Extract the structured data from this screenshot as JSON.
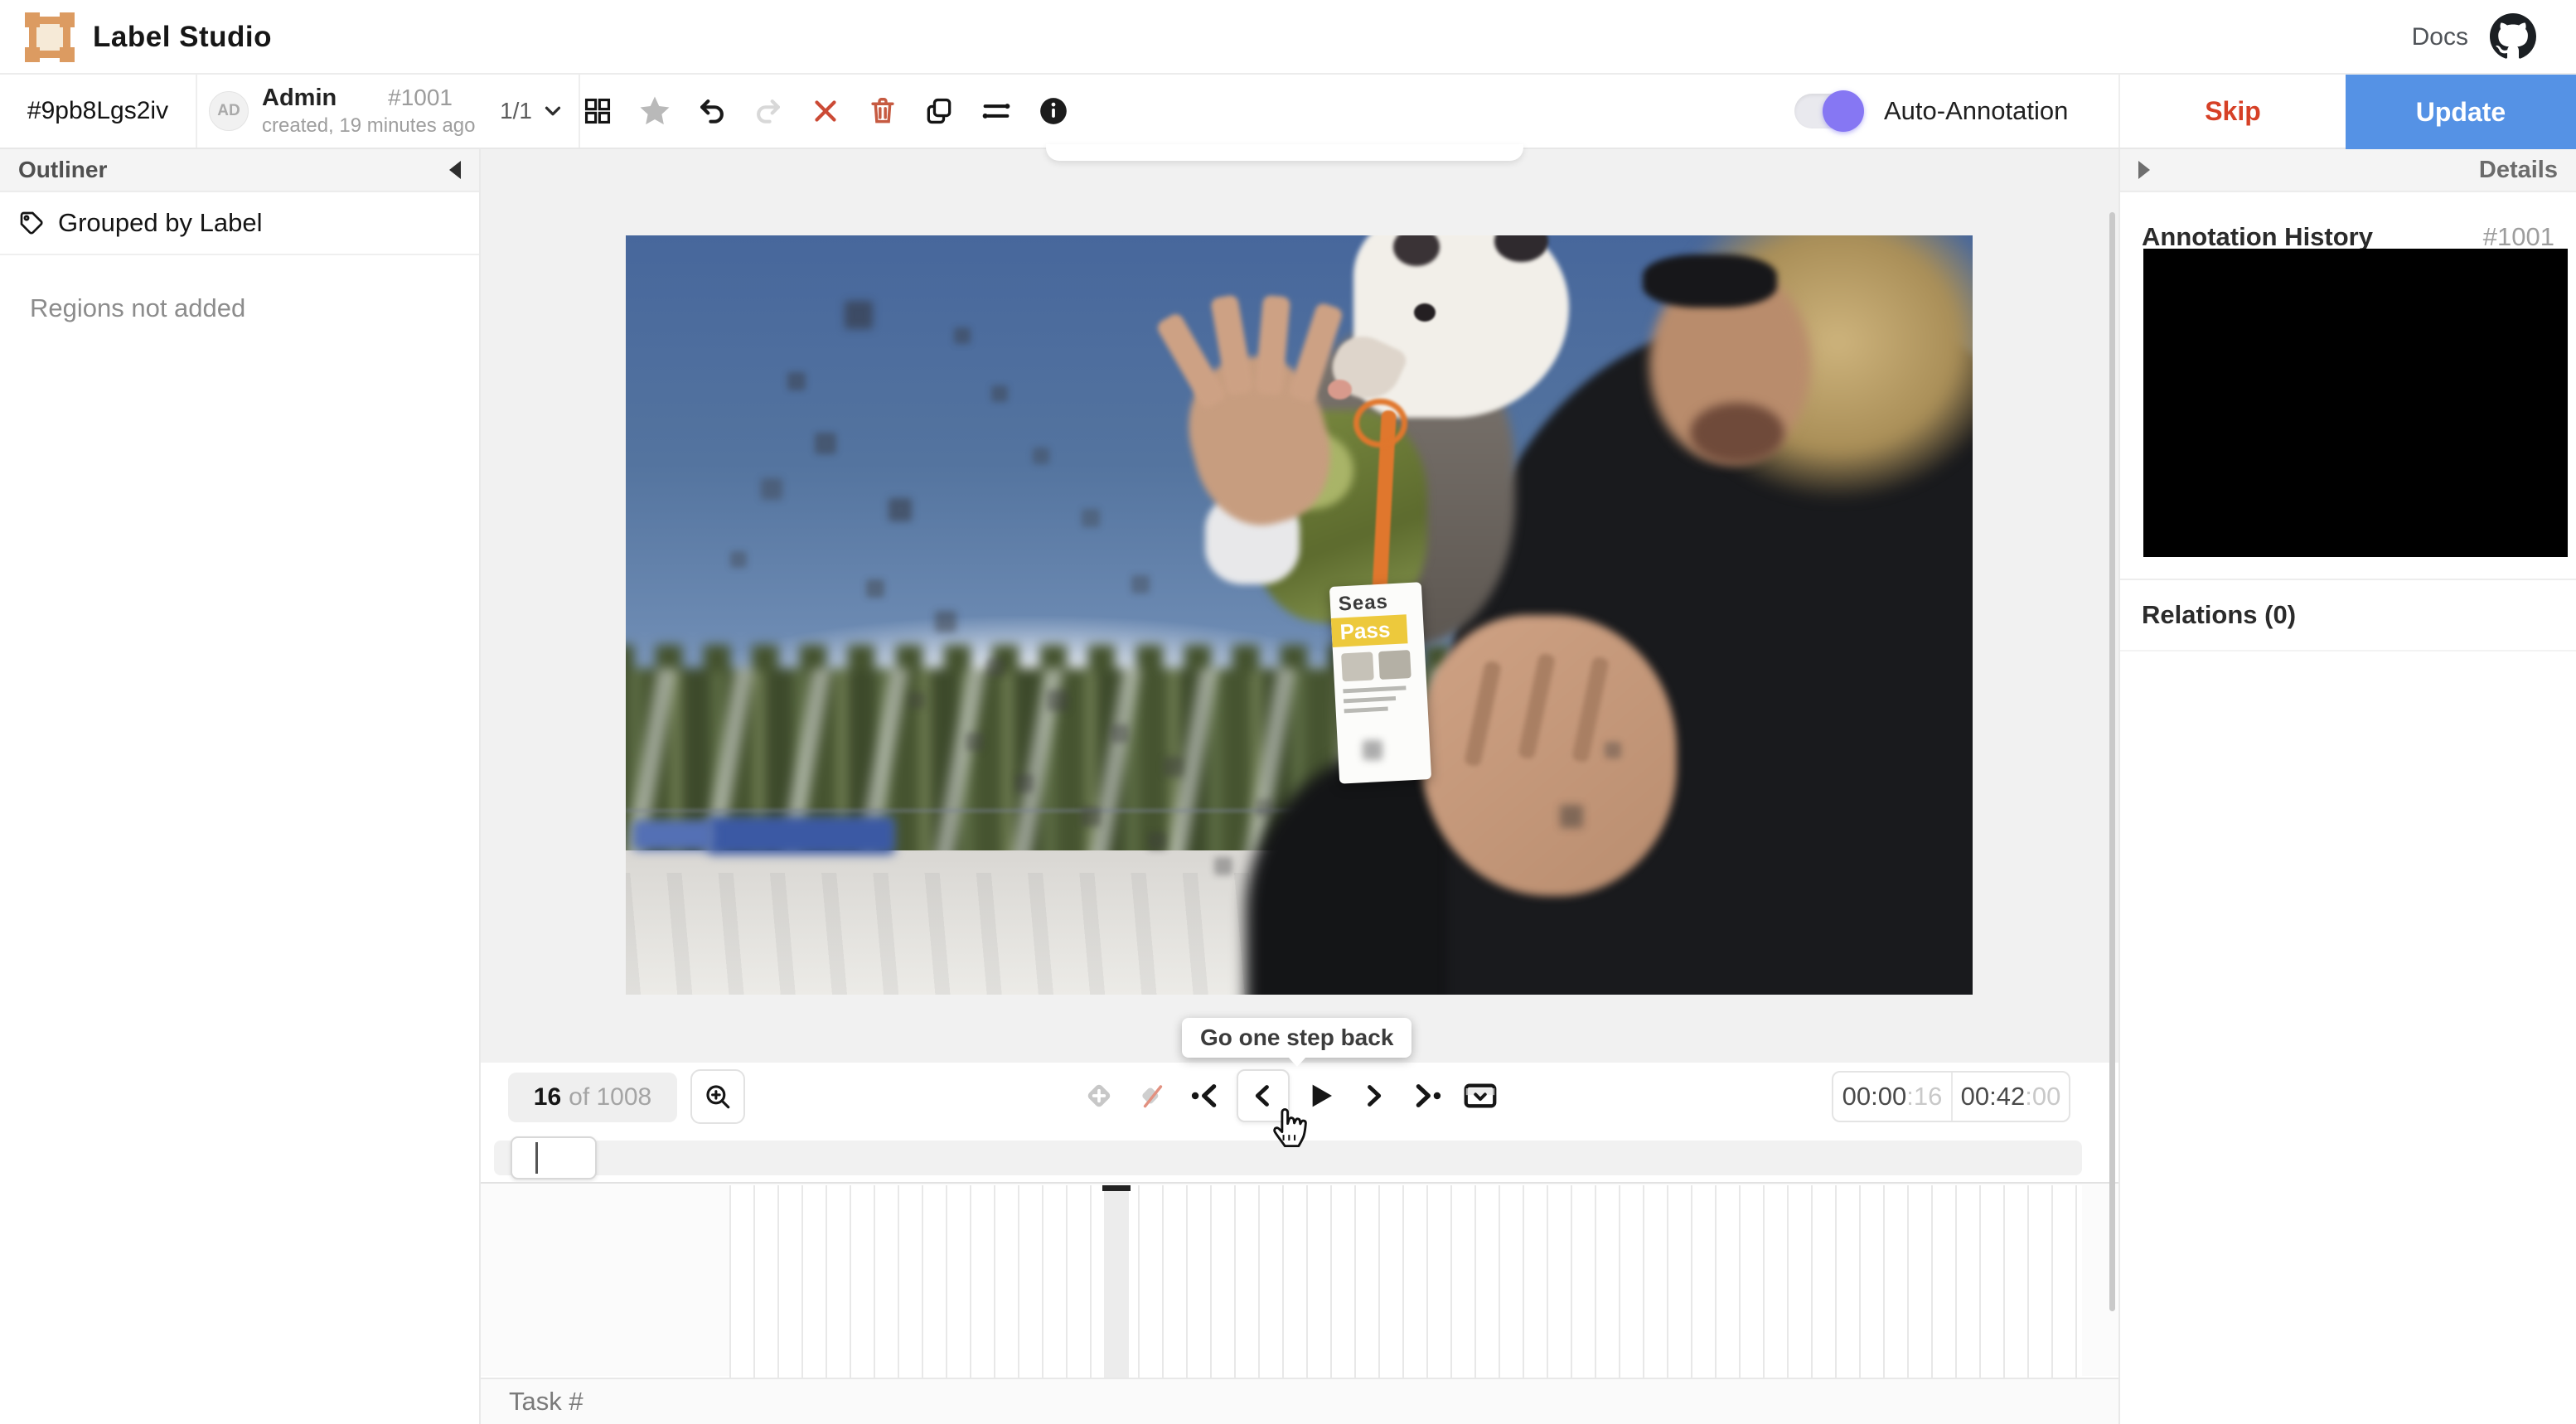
{
  "header": {
    "app_title": "Label Studio",
    "docs_label": "Docs"
  },
  "taskbar": {
    "task_id": "#9pb8Lgs2iv",
    "annotator": {
      "initials": "AD",
      "name": "Admin",
      "annotation_id": "#1001",
      "created_info": "created, 19 minutes ago",
      "pager": "1/1"
    },
    "toolbar_icons": [
      "grid-view",
      "star",
      "undo",
      "redo",
      "reject",
      "delete",
      "duplicate",
      "relations",
      "info"
    ],
    "auto_annotation_label": "Auto-Annotation",
    "skip_label": "Skip",
    "update_label": "Update"
  },
  "outliner": {
    "title": "Outliner",
    "grouping": "Grouped by Label",
    "empty_message": "Regions not added"
  },
  "player": {
    "frame_current": "16",
    "frame_total_label": "of 1008",
    "tooltip": "Go one step back",
    "time_current_main": "00:00",
    "time_current_frames": ":16",
    "time_total_main": "00:42",
    "time_total_frames": ":00"
  },
  "video_overlay": {
    "badge_line1": "Seas",
    "badge_line2": "Pass"
  },
  "details_panel": {
    "title": "Details",
    "history_title": "Annotation History",
    "history_id": "#1001",
    "relations_title": "Relations (0)"
  },
  "bottom_bar": {
    "task_label": "Task #"
  },
  "colors": {
    "accent_blue": "#5592e5",
    "skip_red": "#d64026",
    "toggle_violet": "#8677f3",
    "logo_orange": "#dc9b61",
    "danger_icon": "#cb4a35"
  }
}
